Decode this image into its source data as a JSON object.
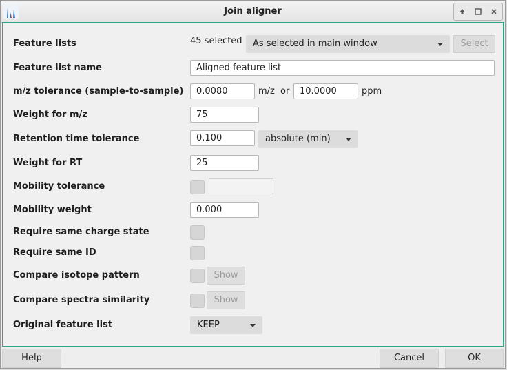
{
  "window": {
    "title": "Join aligner",
    "controls": [
      "up-arrow-icon",
      "maximize-icon",
      "close-icon"
    ]
  },
  "form": {
    "feature_lists": {
      "label": "Feature lists",
      "count_text": "45 selected",
      "mode": "As selected in main window",
      "select_button": "Select"
    },
    "feature_list_name": {
      "label": "Feature list name",
      "value": "Aligned feature list"
    },
    "mz_tolerance": {
      "label": "m/z tolerance (sample-to-sample)",
      "mz_value": "0.0080",
      "mz_unit": "m/z",
      "or_text": "or",
      "ppm_value": "10.0000",
      "ppm_unit": "ppm"
    },
    "weight_mz": {
      "label": "Weight for m/z",
      "value": "75"
    },
    "rt_tolerance": {
      "label": "Retention time tolerance",
      "value": "0.100",
      "unit": "absolute (min)"
    },
    "weight_rt": {
      "label": "Weight for RT",
      "value": "25"
    },
    "mobility_tolerance": {
      "label": "Mobility tolerance",
      "checked": false,
      "value": ""
    },
    "mobility_weight": {
      "label": "Mobility weight",
      "value": "0.000"
    },
    "require_same_charge": {
      "label": "Require same charge state",
      "checked": false
    },
    "require_same_id": {
      "label": "Require same ID",
      "checked": false
    },
    "compare_isotope": {
      "label": "Compare isotope pattern",
      "checked": false,
      "show_button": "Show"
    },
    "compare_spectra": {
      "label": "Compare spectra similarity",
      "checked": false,
      "show_button": "Show"
    },
    "original_feature_list": {
      "label": "Original feature list",
      "value": "KEEP"
    }
  },
  "footer": {
    "help": "Help",
    "cancel": "Cancel",
    "ok": "OK"
  },
  "colors": {
    "content_border": "#2fa68a",
    "dialog_bg": "#f0f0f0"
  }
}
